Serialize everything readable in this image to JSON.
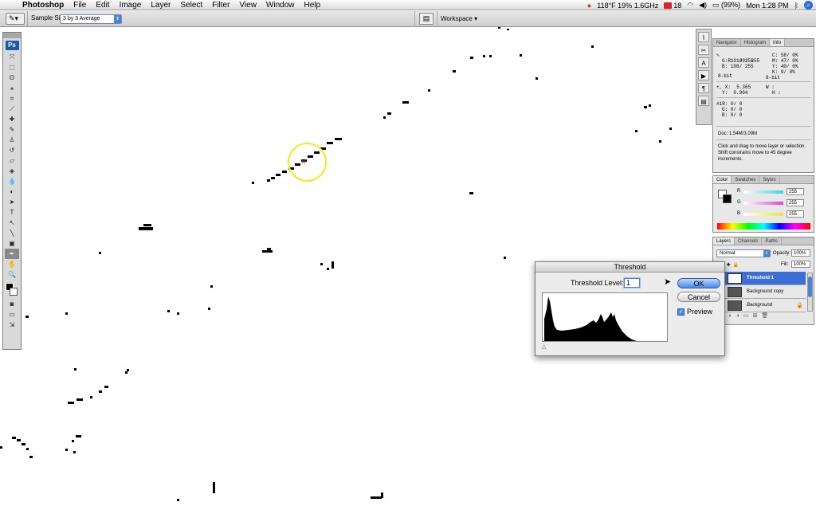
{
  "menubar": {
    "app_name": "Photoshop",
    "items": [
      "File",
      "Edit",
      "Image",
      "Layer",
      "Select",
      "Filter",
      "View",
      "Window",
      "Help"
    ],
    "status": {
      "sysinfo": "118°F 19% 1.6GHz",
      "mail_count": "18",
      "battery": "(99%)",
      "clock": "Mon 1:28 PM"
    }
  },
  "options_bar": {
    "sample_size_label": "Sample Size:",
    "sample_size_value": "3 by 3 Average",
    "workspace_label": "Workspace"
  },
  "toolbox": {
    "logo": "Ps"
  },
  "info_panel": {
    "tabs": [
      "Navigator",
      "Histogram",
      "Info"
    ],
    "rgb": {
      "r": "99/ 255",
      "g": "101/ 255",
      "b": "108/ 255"
    },
    "cmyk": {
      "c": "58/ 0%",
      "m": "47/ 0%",
      "y": "40/ 0%",
      "k": "9/ 0%"
    },
    "bitdepth_left": "8-bit",
    "bitdepth_right": "8-bit",
    "pos": {
      "x": "5.365",
      "y": "0.904"
    },
    "size": {
      "w": "W :",
      "h": "H :"
    },
    "sample2": {
      "r": "0/ 0",
      "g": "0/ 0",
      "b": "0/ 0"
    },
    "doc": "Doc: 1.54M/3.09M",
    "hint": "Click and drag to move layer or selection.\nShift constrains move to 45 degree\nincrements."
  },
  "color_panel": {
    "tabs": [
      "Color",
      "Swatches",
      "Styles"
    ],
    "r": "255",
    "g": "255",
    "b": "255",
    "cyan_color": "#3ed0e6",
    "magenta_color": "#e040e0",
    "yellow_color": "#e6e63e"
  },
  "layers_panel": {
    "tabs": [
      "Layers",
      "Channels",
      "Paths"
    ],
    "blend_mode": "Normal",
    "opacity_label": "Opacity:",
    "opacity": "100%",
    "fill_label": "Fill:",
    "fill": "100%",
    "layers": [
      {
        "name": "Threshold 1"
      },
      {
        "name": "Background copy"
      },
      {
        "name": "Background"
      }
    ]
  },
  "threshold_dialog": {
    "title": "Threshold",
    "level_label": "Threshold Level:",
    "level_value": "1",
    "ok": "OK",
    "cancel": "Cancel",
    "preview": "Preview"
  }
}
